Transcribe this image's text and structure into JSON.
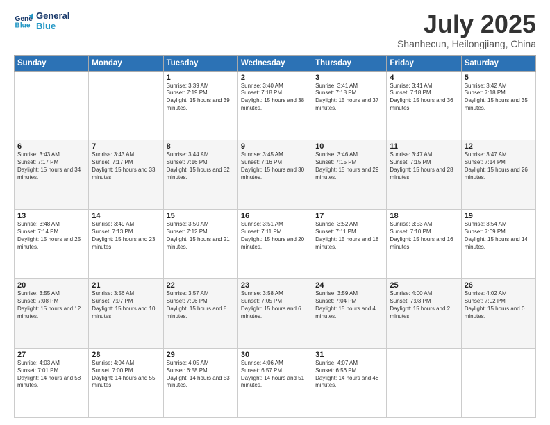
{
  "logo": {
    "line1": "General",
    "line2": "Blue"
  },
  "header": {
    "month": "July 2025",
    "location": "Shanhecun, Heilongjiang, China"
  },
  "weekdays": [
    "Sunday",
    "Monday",
    "Tuesday",
    "Wednesday",
    "Thursday",
    "Friday",
    "Saturday"
  ],
  "weeks": [
    [
      {
        "day": "",
        "sunrise": "",
        "sunset": "",
        "daylight": ""
      },
      {
        "day": "",
        "sunrise": "",
        "sunset": "",
        "daylight": ""
      },
      {
        "day": "1",
        "sunrise": "Sunrise: 3:39 AM",
        "sunset": "Sunset: 7:19 PM",
        "daylight": "Daylight: 15 hours and 39 minutes."
      },
      {
        "day": "2",
        "sunrise": "Sunrise: 3:40 AM",
        "sunset": "Sunset: 7:18 PM",
        "daylight": "Daylight: 15 hours and 38 minutes."
      },
      {
        "day": "3",
        "sunrise": "Sunrise: 3:41 AM",
        "sunset": "Sunset: 7:18 PM",
        "daylight": "Daylight: 15 hours and 37 minutes."
      },
      {
        "day": "4",
        "sunrise": "Sunrise: 3:41 AM",
        "sunset": "Sunset: 7:18 PM",
        "daylight": "Daylight: 15 hours and 36 minutes."
      },
      {
        "day": "5",
        "sunrise": "Sunrise: 3:42 AM",
        "sunset": "Sunset: 7:18 PM",
        "daylight": "Daylight: 15 hours and 35 minutes."
      }
    ],
    [
      {
        "day": "6",
        "sunrise": "Sunrise: 3:43 AM",
        "sunset": "Sunset: 7:17 PM",
        "daylight": "Daylight: 15 hours and 34 minutes."
      },
      {
        "day": "7",
        "sunrise": "Sunrise: 3:43 AM",
        "sunset": "Sunset: 7:17 PM",
        "daylight": "Daylight: 15 hours and 33 minutes."
      },
      {
        "day": "8",
        "sunrise": "Sunrise: 3:44 AM",
        "sunset": "Sunset: 7:16 PM",
        "daylight": "Daylight: 15 hours and 32 minutes."
      },
      {
        "day": "9",
        "sunrise": "Sunrise: 3:45 AM",
        "sunset": "Sunset: 7:16 PM",
        "daylight": "Daylight: 15 hours and 30 minutes."
      },
      {
        "day": "10",
        "sunrise": "Sunrise: 3:46 AM",
        "sunset": "Sunset: 7:15 PM",
        "daylight": "Daylight: 15 hours and 29 minutes."
      },
      {
        "day": "11",
        "sunrise": "Sunrise: 3:47 AM",
        "sunset": "Sunset: 7:15 PM",
        "daylight": "Daylight: 15 hours and 28 minutes."
      },
      {
        "day": "12",
        "sunrise": "Sunrise: 3:47 AM",
        "sunset": "Sunset: 7:14 PM",
        "daylight": "Daylight: 15 hours and 26 minutes."
      }
    ],
    [
      {
        "day": "13",
        "sunrise": "Sunrise: 3:48 AM",
        "sunset": "Sunset: 7:14 PM",
        "daylight": "Daylight: 15 hours and 25 minutes."
      },
      {
        "day": "14",
        "sunrise": "Sunrise: 3:49 AM",
        "sunset": "Sunset: 7:13 PM",
        "daylight": "Daylight: 15 hours and 23 minutes."
      },
      {
        "day": "15",
        "sunrise": "Sunrise: 3:50 AM",
        "sunset": "Sunset: 7:12 PM",
        "daylight": "Daylight: 15 hours and 21 minutes."
      },
      {
        "day": "16",
        "sunrise": "Sunrise: 3:51 AM",
        "sunset": "Sunset: 7:11 PM",
        "daylight": "Daylight: 15 hours and 20 minutes."
      },
      {
        "day": "17",
        "sunrise": "Sunrise: 3:52 AM",
        "sunset": "Sunset: 7:11 PM",
        "daylight": "Daylight: 15 hours and 18 minutes."
      },
      {
        "day": "18",
        "sunrise": "Sunrise: 3:53 AM",
        "sunset": "Sunset: 7:10 PM",
        "daylight": "Daylight: 15 hours and 16 minutes."
      },
      {
        "day": "19",
        "sunrise": "Sunrise: 3:54 AM",
        "sunset": "Sunset: 7:09 PM",
        "daylight": "Daylight: 15 hours and 14 minutes."
      }
    ],
    [
      {
        "day": "20",
        "sunrise": "Sunrise: 3:55 AM",
        "sunset": "Sunset: 7:08 PM",
        "daylight": "Daylight: 15 hours and 12 minutes."
      },
      {
        "day": "21",
        "sunrise": "Sunrise: 3:56 AM",
        "sunset": "Sunset: 7:07 PM",
        "daylight": "Daylight: 15 hours and 10 minutes."
      },
      {
        "day": "22",
        "sunrise": "Sunrise: 3:57 AM",
        "sunset": "Sunset: 7:06 PM",
        "daylight": "Daylight: 15 hours and 8 minutes."
      },
      {
        "day": "23",
        "sunrise": "Sunrise: 3:58 AM",
        "sunset": "Sunset: 7:05 PM",
        "daylight": "Daylight: 15 hours and 6 minutes."
      },
      {
        "day": "24",
        "sunrise": "Sunrise: 3:59 AM",
        "sunset": "Sunset: 7:04 PM",
        "daylight": "Daylight: 15 hours and 4 minutes."
      },
      {
        "day": "25",
        "sunrise": "Sunrise: 4:00 AM",
        "sunset": "Sunset: 7:03 PM",
        "daylight": "Daylight: 15 hours and 2 minutes."
      },
      {
        "day": "26",
        "sunrise": "Sunrise: 4:02 AM",
        "sunset": "Sunset: 7:02 PM",
        "daylight": "Daylight: 15 hours and 0 minutes."
      }
    ],
    [
      {
        "day": "27",
        "sunrise": "Sunrise: 4:03 AM",
        "sunset": "Sunset: 7:01 PM",
        "daylight": "Daylight: 14 hours and 58 minutes."
      },
      {
        "day": "28",
        "sunrise": "Sunrise: 4:04 AM",
        "sunset": "Sunset: 7:00 PM",
        "daylight": "Daylight: 14 hours and 55 minutes."
      },
      {
        "day": "29",
        "sunrise": "Sunrise: 4:05 AM",
        "sunset": "Sunset: 6:58 PM",
        "daylight": "Daylight: 14 hours and 53 minutes."
      },
      {
        "day": "30",
        "sunrise": "Sunrise: 4:06 AM",
        "sunset": "Sunset: 6:57 PM",
        "daylight": "Daylight: 14 hours and 51 minutes."
      },
      {
        "day": "31",
        "sunrise": "Sunrise: 4:07 AM",
        "sunset": "Sunset: 6:56 PM",
        "daylight": "Daylight: 14 hours and 48 minutes."
      },
      {
        "day": "",
        "sunrise": "",
        "sunset": "",
        "daylight": ""
      },
      {
        "day": "",
        "sunrise": "",
        "sunset": "",
        "daylight": ""
      }
    ]
  ]
}
